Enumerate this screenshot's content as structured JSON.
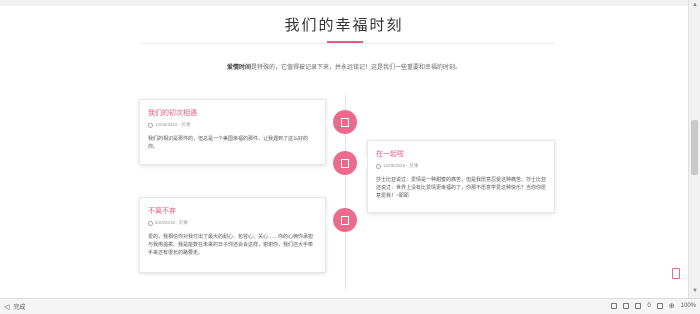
{
  "page": {
    "title": "我们的幸福时刻",
    "intro_bold": "爱情时间",
    "intro_rest": "是特殊的，它值得被记录下来，并永远铭记！这是我们一些重要和幸福的时刻。"
  },
  "timeline": [
    {
      "title": "我们的初次相遇",
      "meta": "12/06/2016 - 於果",
      "text": "我们的相识是那件的，但总是一个美国幸福的那件，让我遇到了这么好的你。",
      "side": "left"
    },
    {
      "title": "在一起啦",
      "meta": "12/06/2016 - 於果",
      "text": "莎士比亚说过：爱情是一种甜蜜的痛苦，但是我愿意忍受这种痛苦。莎士比亚还说过：世界上没有比爱情更幸福的了，你那不愿意学爱这种快乐？当你你愿意爱我！~耶耶",
      "side": "right"
    },
    {
      "title": "不离不弃",
      "meta": "6/23/2016 - 於果",
      "text": "爱的，我相信你对我付出了最大的耐心、包容心、关心……你的心俩你承担与我用温柔。我是能数在未来的日子你还会会这样，谢谢你，我们还大手牵手来还有很长的路要走。",
      "side": "left"
    }
  ],
  "statusbar": {
    "status": "完成",
    "count": "0",
    "zoom": "100%"
  },
  "colors": {
    "accent": "#e8557d",
    "dot": "#ec6a8c"
  }
}
